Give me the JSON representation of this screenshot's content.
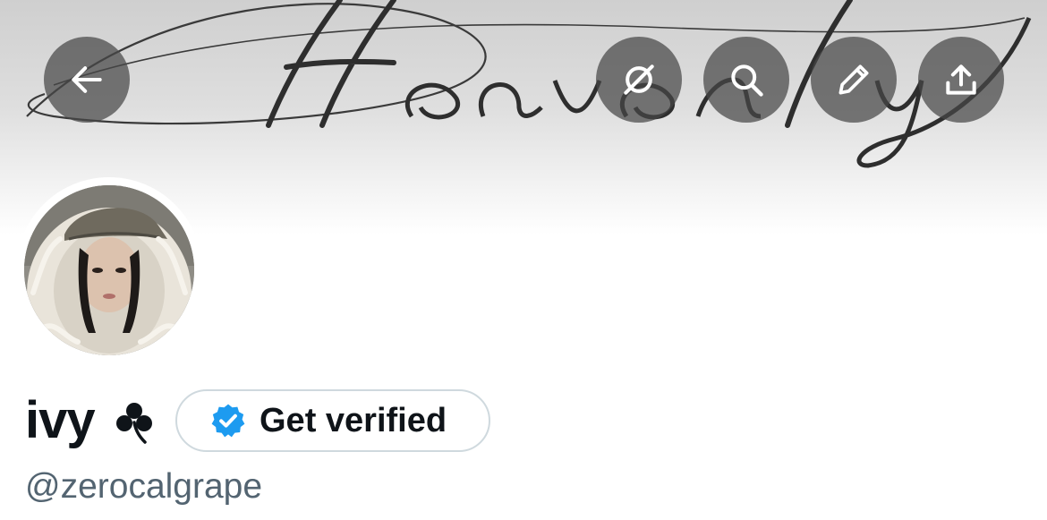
{
  "banner": {
    "script_text": "Heavenly"
  },
  "toolbar": {
    "back_icon": "arrow-left-icon",
    "grok_icon": "grok-icon",
    "search_icon": "search-icon",
    "edit_icon": "pencil-icon",
    "share_icon": "share-upload-icon"
  },
  "profile": {
    "display_name": "ivy",
    "name_emoji": "shamrock-icon",
    "handle": "@zerocalgrape",
    "get_verified_label": "Get verified",
    "verified_badge_icon": "verified-badge-icon"
  },
  "colors": {
    "text_primary": "#0f1419",
    "text_secondary": "#536471",
    "verified_blue": "#1d9bf0",
    "button_border": "#cfd9de",
    "overlay_button": "#464646"
  }
}
